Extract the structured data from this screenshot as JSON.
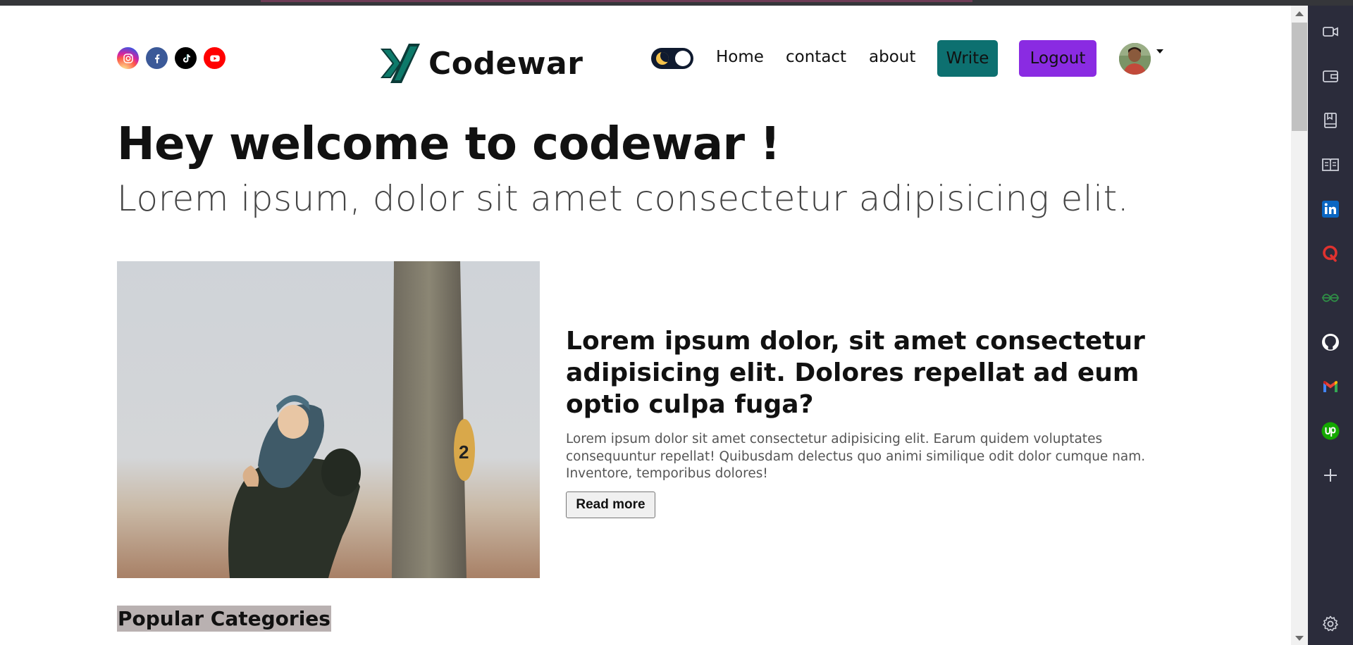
{
  "header": {
    "socials": [
      {
        "name": "instagram",
        "icon": "instagram-icon"
      },
      {
        "name": "facebook",
        "icon": "facebook-icon"
      },
      {
        "name": "tiktok",
        "icon": "tiktok-icon"
      },
      {
        "name": "youtube",
        "icon": "youtube-icon"
      }
    ],
    "logo_text": "Codewar",
    "theme_toggle": {
      "state": "dark",
      "icon": "moon-icon"
    },
    "nav": {
      "home": "Home",
      "contact": "contact",
      "about": "about"
    },
    "write_label": "Write",
    "logout_label": "Logout"
  },
  "hero": {
    "title": "Hey welcome to codewar !",
    "subtitle": "Lorem ipsum, dolor sit amet consectetur adipisicing elit."
  },
  "featured_post": {
    "title": "Lorem ipsum dolor, sit amet consectetur adipisicing elit. Dolores repellat ad eum optio culpa fuga?",
    "description": "Lorem ipsum dolor sit amet consectetur adipisicing elit. Earum quidem voluptates consequuntur repellat! Quibusdam delectus quo animi similique odit dolor cumque nam. Inventore, temporibus dolores!",
    "read_more_label": "Read more",
    "image_icon": "photo-parent-child-fog"
  },
  "sections": {
    "popular_categories": "Popular Categories"
  },
  "side_panel": {
    "icons": [
      "video-icon",
      "wallet-icon",
      "bookmark-book-icon",
      "reading-list-icon",
      "linkedin-icon",
      "quora-icon",
      "geeksforgeeks-icon",
      "github-icon",
      "gmail-icon",
      "upwork-icon",
      "add-icon",
      "settings-icon"
    ]
  },
  "colors": {
    "write_button": "#0d7070",
    "logout_button": "#8a2be2",
    "side_panel_bg": "#2b2c3b",
    "popular_highlight": "#b9b1b1"
  }
}
